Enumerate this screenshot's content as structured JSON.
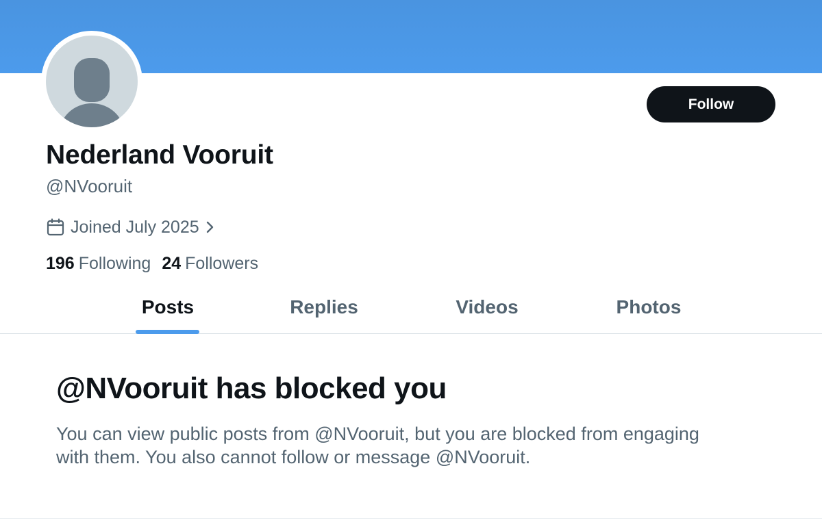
{
  "profile": {
    "display_name": "Nederland Vooruit",
    "handle": "@NVooruit",
    "joined": "Joined July 2025",
    "following_count": "196",
    "following_label": "Following",
    "followers_count": "24",
    "followers_label": "Followers"
  },
  "actions": {
    "follow_label": "Follow"
  },
  "tabs": [
    {
      "label": "Posts",
      "active": true
    },
    {
      "label": "Replies",
      "active": false
    },
    {
      "label": "Videos",
      "active": false
    },
    {
      "label": "Photos",
      "active": false
    }
  ],
  "blocked": {
    "title": "@NVooruit has blocked you",
    "message": "You can view public posts from @NVooruit, but you are blocked from engaging with them. You also cannot follow or message @NVooruit."
  },
  "icons": {
    "calendar": "calendar-icon",
    "chevron": "chevron-right-icon",
    "avatar": "default-avatar-icon"
  },
  "colors": {
    "banner": "#4c9bec",
    "accent": "#4c9bec",
    "button_bg": "#0f1419",
    "text_primary": "#0f1419",
    "text_secondary": "#536471"
  }
}
